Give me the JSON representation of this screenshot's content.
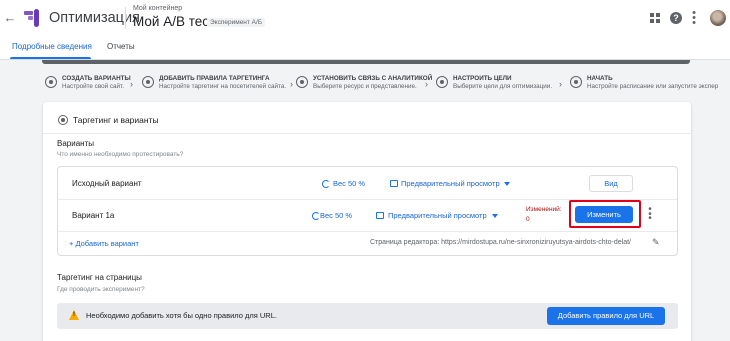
{
  "header": {
    "back_icon": "arrow-back-icon",
    "app_title": "Оптимизация",
    "container_label": "Мой контейнер",
    "experiment_title": "Мой А/B тест",
    "experiment_type": "Эксперимент А/Б"
  },
  "tabs": [
    {
      "label": "Подробные сведения",
      "active": true
    },
    {
      "label": "Отчеты",
      "active": false
    }
  ],
  "steps": [
    {
      "title": "СОЗДАТЬ ВАРИАНТЫ",
      "subtitle": "Настройте свой сайт."
    },
    {
      "title": "ДОБАВИТЬ ПРАВИЛА ТАРГЕТИНГА",
      "subtitle": "Настройте таргетинг на посетителей сайта."
    },
    {
      "title": "УСТАНОВИТЬ СВЯЗЬ С АНАЛИТИКОЙ",
      "subtitle": "Выберите ресурс и представление."
    },
    {
      "title": "НАСТРОИТЬ ЦЕЛИ",
      "subtitle": "Выберите цели для оптимизации."
    },
    {
      "title": "НАЧАТЬ",
      "subtitle": "Настройте расписание или запустите экспер"
    }
  ],
  "card": {
    "title": "Таргетинг и варианты",
    "variants_title": "Варианты",
    "variants_subtitle": "Что именно необходимо протестировать?",
    "original": {
      "name": "Исходный вариант",
      "weight": "Вес 50 %",
      "preview": "Предварительный просмотр",
      "view_button": "Вид"
    },
    "variant": {
      "name": "Вариант 1а",
      "weight": "Вес 50 %",
      "preview": "Предварительный просмотр",
      "changes_label": "Изменений:",
      "changes_count": "0",
      "edit_button": "Изменить"
    },
    "add_variant": "+ Добавить вариант",
    "editor_page": "Страница редактора: https://mirdostupa.ru/ne-sinxroniziruyutsya-airdots-chto-delat/",
    "targeting_title": "Таргетинг на страницы",
    "targeting_subtitle": "Где проводить эксперимент?",
    "warning": "Необходимо добавить хотя бы одно правило для URL.",
    "add_rule_button": "Добавить правило для URL"
  },
  "colors": {
    "accent": "#1a73e8",
    "highlight": "#e1001a",
    "warning": "#f9ab00",
    "logo": "#7e57c2"
  }
}
